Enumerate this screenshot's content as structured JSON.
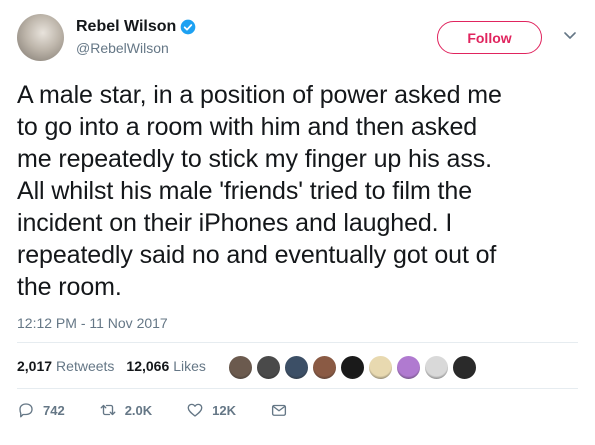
{
  "author": {
    "name": "Rebel Wilson",
    "handle": "@RebelWilson"
  },
  "follow_label": "Follow",
  "tweet_lines": [
    "A male star, in a position of power asked me",
    "to go into a room with him and then asked",
    "me repeatedly to stick my finger up his ass.",
    "All whilst his male 'friends' tried to film the",
    "incident on their iPhones and laughed. I",
    "repeatedly said no and eventually got out of",
    "the room."
  ],
  "timestamp": "12:12 PM - 11 Nov 2017",
  "stats": {
    "retweets_count": "2,017",
    "retweets_label": "Retweets",
    "likes_count": "12,066",
    "likes_label": "Likes"
  },
  "liker_colors": [
    "#6b5a4e",
    "#4a4a4a",
    "#3c4f66",
    "#8a5a44",
    "#1a1a1a",
    "#e8d9b0",
    "#b07ad0",
    "#d9d9d9",
    "#2a2a2a"
  ],
  "actions": {
    "replies": "742",
    "retweets": "2.0K",
    "likes": "12K"
  },
  "colors": {
    "accent": "#e0245e",
    "verified": "#1da1f2",
    "muted": "#657786"
  }
}
